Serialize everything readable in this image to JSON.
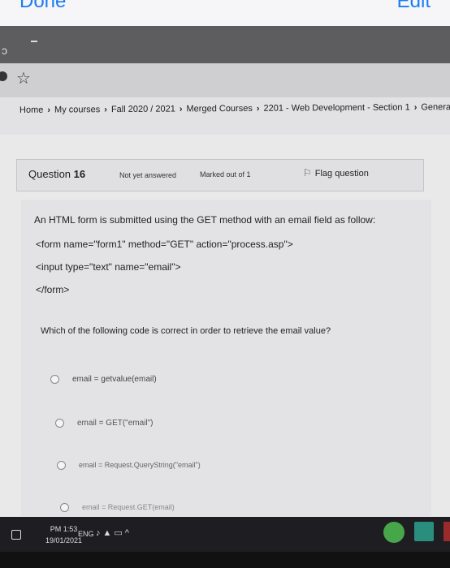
{
  "phone": {
    "done_label": "Done",
    "edit_label": "Edit"
  },
  "breadcrumb": [
    "Home",
    "My courses",
    "Fall 2020 / 2021",
    "Merged Courses",
    "2201 - Web Development - Section 1",
    "Genera"
  ],
  "question_info": {
    "label": "Question",
    "number": "16",
    "state": "Not yet answered",
    "marked": "Marked out of 1",
    "flag_label": "Flag question"
  },
  "question": {
    "text": "An HTML form is submitted using the GET method with an email field as follow:",
    "code_line1": "<form name=\"form1\" method=\"GET\" action=\"process.asp\">",
    "code_line2": "<input type=\"text\" name=\"email\">",
    "code_line3": "</form>",
    "prompt": "Which of the following code is correct in order to retrieve the email value?"
  },
  "options": [
    "email = getvalue(email)",
    "email = GET(\"email\")",
    "email = Request.QueryString(\"email\")",
    "email = Request.GET(email)"
  ],
  "taskbar": {
    "time": "PM 1:53",
    "date": "19/01/2021",
    "lang": "ENG"
  },
  "icons": [
    "star-icon",
    "flag-icon",
    "chevron-right-icon",
    "radio-icon",
    "windows-icon",
    "speaker-icon",
    "network-icon",
    "battery-icon",
    "chevron-up-icon",
    "chrome-icon",
    "app-icon"
  ]
}
